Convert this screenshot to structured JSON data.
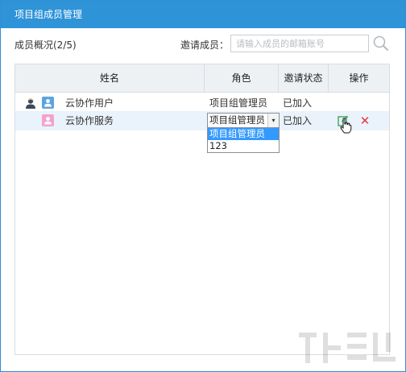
{
  "dialog": {
    "title": "项目组成员管理",
    "close_glyph": "×"
  },
  "summary": {
    "count_label": "成员概况(2/5)",
    "invite_label": "邀请成员：",
    "invite_placeholder": "请输入成员的邮箱账号",
    "invite_value": ""
  },
  "table": {
    "headers": {
      "name": "姓名",
      "role": "角色",
      "status": "邀请状态",
      "operation": "操作"
    },
    "rows": [
      {
        "name": "云协作用户",
        "role": "项目组管理员",
        "status": "已加入",
        "badge_color": "#5ba4e0",
        "is_owner": true
      },
      {
        "name": "云协作服务",
        "role": "项目组管理员",
        "status": "已加入",
        "badge_color": "#f3a2cf",
        "is_owner": false
      }
    ]
  },
  "role_dropdown": {
    "selected": "项目组管理员",
    "options": [
      "项目组管理员",
      "123"
    ],
    "highlight_color": "#3399ff"
  },
  "icons": {
    "owner": "person-icon",
    "badge": "user-badge-icon",
    "search": "search-icon",
    "edit": "edit-icon",
    "delete": "delete-icon",
    "cursor": "hand-cursor-icon"
  },
  "colors": {
    "title_bar": "#2f93d8",
    "delete": "#e53b3b",
    "edit": "#3aa657",
    "row_highlight": "#eaf3fb"
  }
}
